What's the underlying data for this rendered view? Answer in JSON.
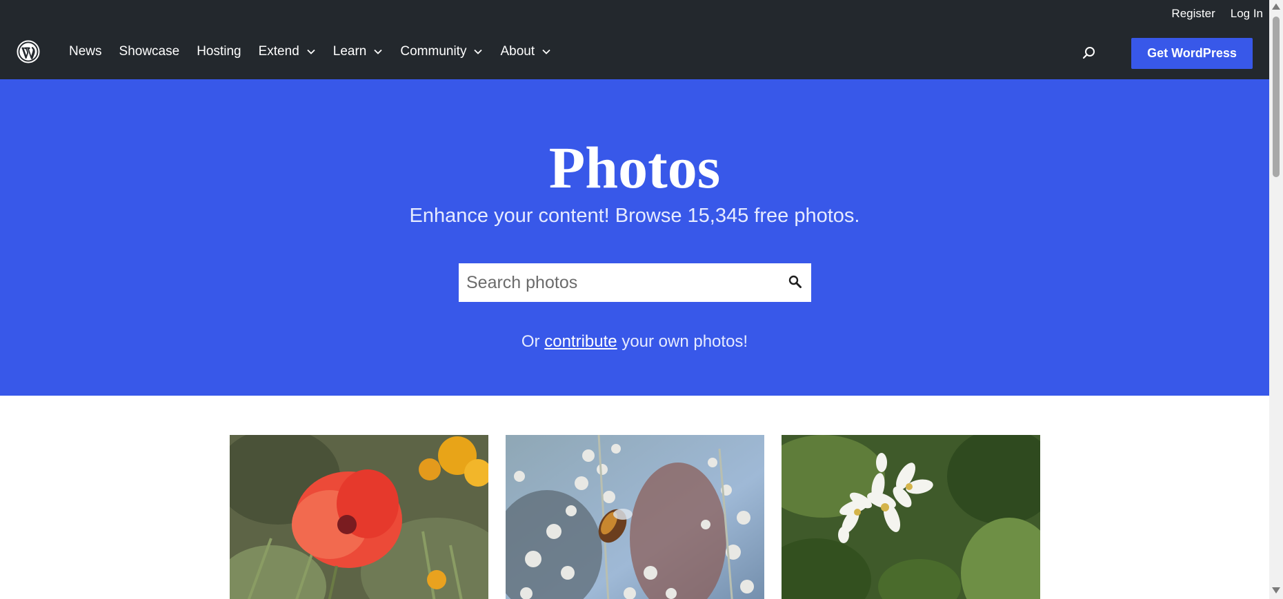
{
  "header": {
    "utility_links": [
      "Register",
      "Log In"
    ],
    "logo_icon": "wordpress-logo-icon",
    "nav": [
      {
        "label": "News",
        "dropdown": false
      },
      {
        "label": "Showcase",
        "dropdown": false
      },
      {
        "label": "Hosting",
        "dropdown": false
      },
      {
        "label": "Extend",
        "dropdown": true
      },
      {
        "label": "Learn",
        "dropdown": true
      },
      {
        "label": "Community",
        "dropdown": true
      },
      {
        "label": "About",
        "dropdown": true
      }
    ],
    "search_icon": "search-icon",
    "cta_label": "Get WordPress"
  },
  "hero": {
    "title": "Photos",
    "subtitle": "Enhance your content! Browse 15,345 free photos.",
    "search_placeholder": "Search photos",
    "contribute_prefix": "Or",
    "contribute_link": "contribute",
    "contribute_suffix": "your own photos!"
  },
  "photos": [
    {
      "subject": "red poppy flower"
    },
    {
      "subject": "bee on white blossoms"
    },
    {
      "subject": "white orange blossoms"
    }
  ],
  "colors": {
    "header_bg": "#23282d",
    "accent": "#3858e9",
    "hero_text": "#ffffff"
  }
}
